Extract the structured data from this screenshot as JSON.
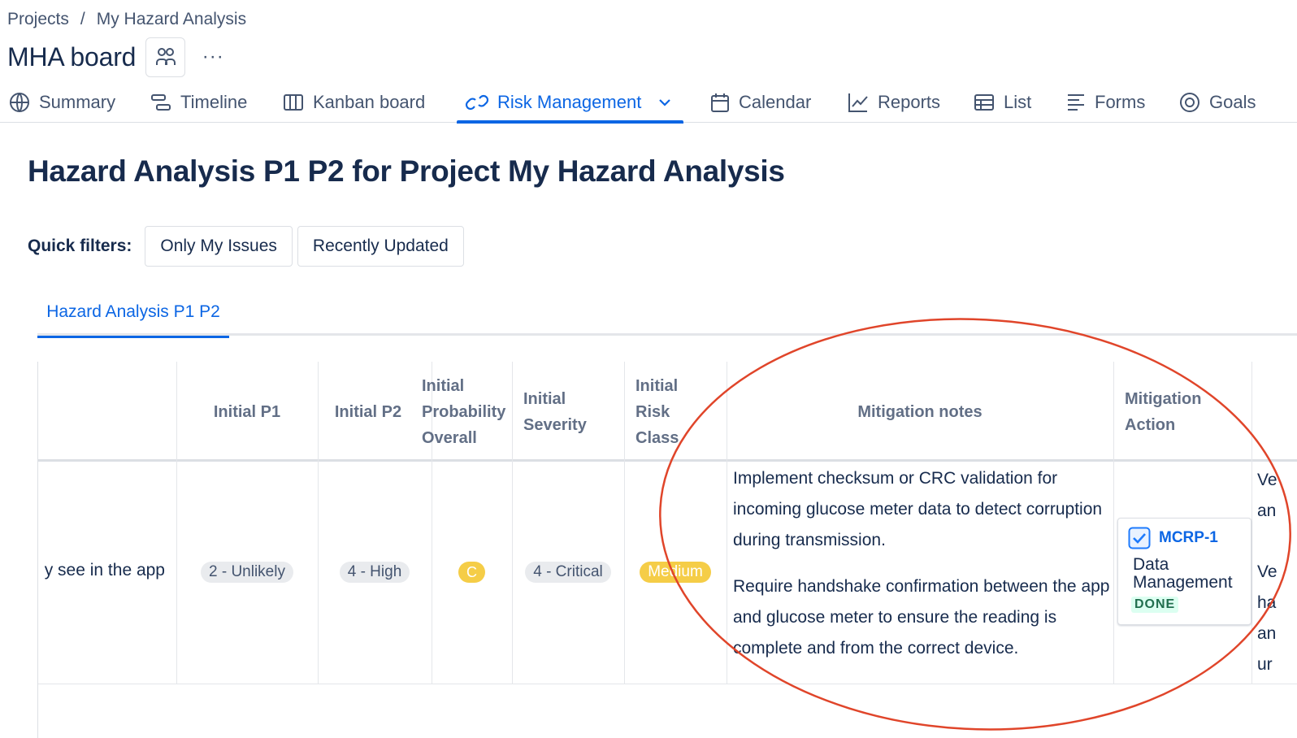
{
  "breadcrumb": {
    "projects": "Projects",
    "separator": "/",
    "current": "My Hazard Analysis"
  },
  "board": {
    "title": "MHA board",
    "more": "···"
  },
  "nav": {
    "summary": "Summary",
    "timeline": "Timeline",
    "kanban": "Kanban board",
    "risk": "Risk Management",
    "calendar": "Calendar",
    "reports": "Reports",
    "list": "List",
    "forms": "Forms",
    "goals": "Goals"
  },
  "page": {
    "title": "Hazard Analysis P1 P2 for Project My Hazard Analysis",
    "quick_filters_label": "Quick filters:",
    "filters": {
      "only_mine": "Only My Issues",
      "recent": "Recently Updated"
    },
    "subtab": "Hazard Analysis P1 P2"
  },
  "table": {
    "headers": {
      "p1": "Initial P1",
      "p2": "Initial P2",
      "prob": [
        "Initial",
        "Probability",
        "Overall"
      ],
      "severity": [
        "Initial",
        "Severity"
      ],
      "risk": [
        "Initial",
        "Risk",
        "Class"
      ],
      "notes": "Mitigation notes",
      "action": [
        "Mitigation",
        "Action"
      ]
    },
    "row": {
      "description_fragment": "y see in the app",
      "p1": "2 - Unlikely",
      "p2": "4 - High",
      "prob": "C",
      "severity": "4 - Critical",
      "risk": "Medium",
      "notes": [
        "Implement checksum or CRC validation for incoming glucose meter data to detect corruption during transmission.",
        "Require handshake confirmation between the app and glucose meter to ensure the reading is complete and from the correct device."
      ],
      "action": {
        "key": "MCRP-1",
        "title": "Data Management",
        "status": "DONE"
      },
      "clipped_next_column": [
        "Ve",
        "an",
        "",
        "Ve",
        "ha",
        "an",
        "ur"
      ]
    }
  },
  "colors": {
    "accent": "#0c66e4",
    "annotation": "#e0452a",
    "yellow": "#f5cd47"
  }
}
